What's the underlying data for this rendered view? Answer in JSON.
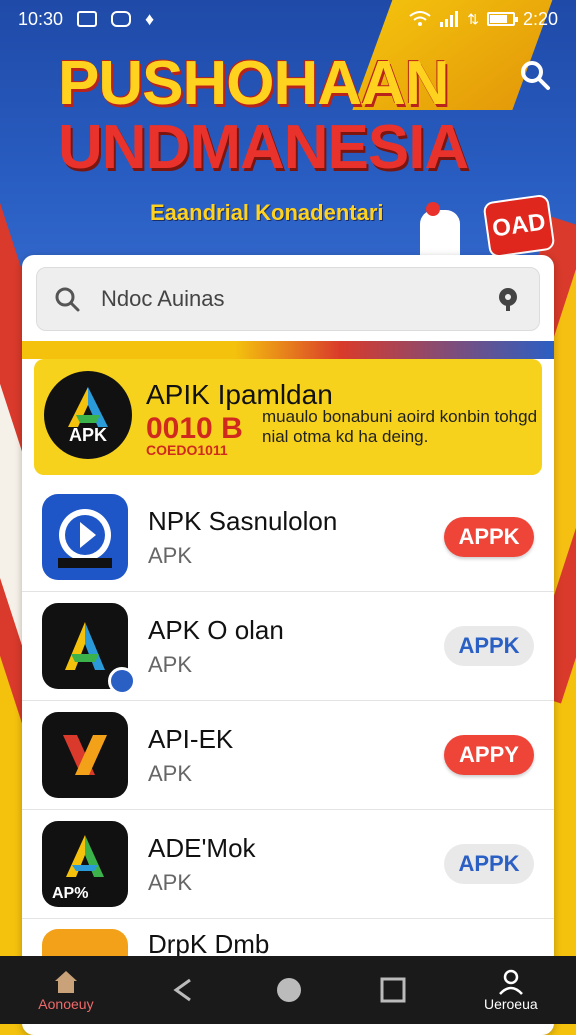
{
  "status_bar": {
    "time_left": "10:30",
    "time_right": "2:20"
  },
  "banner": {
    "title_line1": "PUSHOHAAN",
    "title_line2": "UNDMANESIA",
    "subtitle": "Eaandrial Konadentari",
    "badge_text": "OAD"
  },
  "search": {
    "value": "Ndoc Auinas"
  },
  "featured": {
    "title": "APIK Ipamldan",
    "code": "0010 B",
    "code_small": "COEDO1011",
    "description": "muaulo bonabuni aoird konbin tohgd nial otma kd ha deing.",
    "icon_text": "APK"
  },
  "apps": [
    {
      "name": "NPK Sasnulolon",
      "sub": "APK",
      "button": "APPK",
      "button_style": "red",
      "icon": "apk-logo-blue-icon"
    },
    {
      "name": "APK O olan",
      "sub": "APK",
      "button": "APPK",
      "button_style": "grey",
      "icon": "apk-logo-green-icon"
    },
    {
      "name": "API-EK",
      "sub": "APK",
      "button": "APPY",
      "button_style": "red",
      "icon": "apk-logo-red-icon"
    },
    {
      "name": "ADE'Mok",
      "sub": "APK",
      "button": "APPK",
      "button_style": "grey",
      "icon": "apk-logo-green-icon"
    },
    {
      "name": "DrpK Dmb",
      "sub": "",
      "button": "",
      "button_style": "grey",
      "icon": "apk-logo-orange-icon"
    }
  ],
  "apps_icon_texts": {
    "ade_mok": "AP%"
  },
  "navbar": {
    "home_label": "Aonoeuy",
    "profile_label": "Ueroeua"
  },
  "colors": {
    "primary_blue": "#2a5fc4",
    "accent_red": "#ef4438",
    "banner_yellow": "#f4c20d"
  }
}
